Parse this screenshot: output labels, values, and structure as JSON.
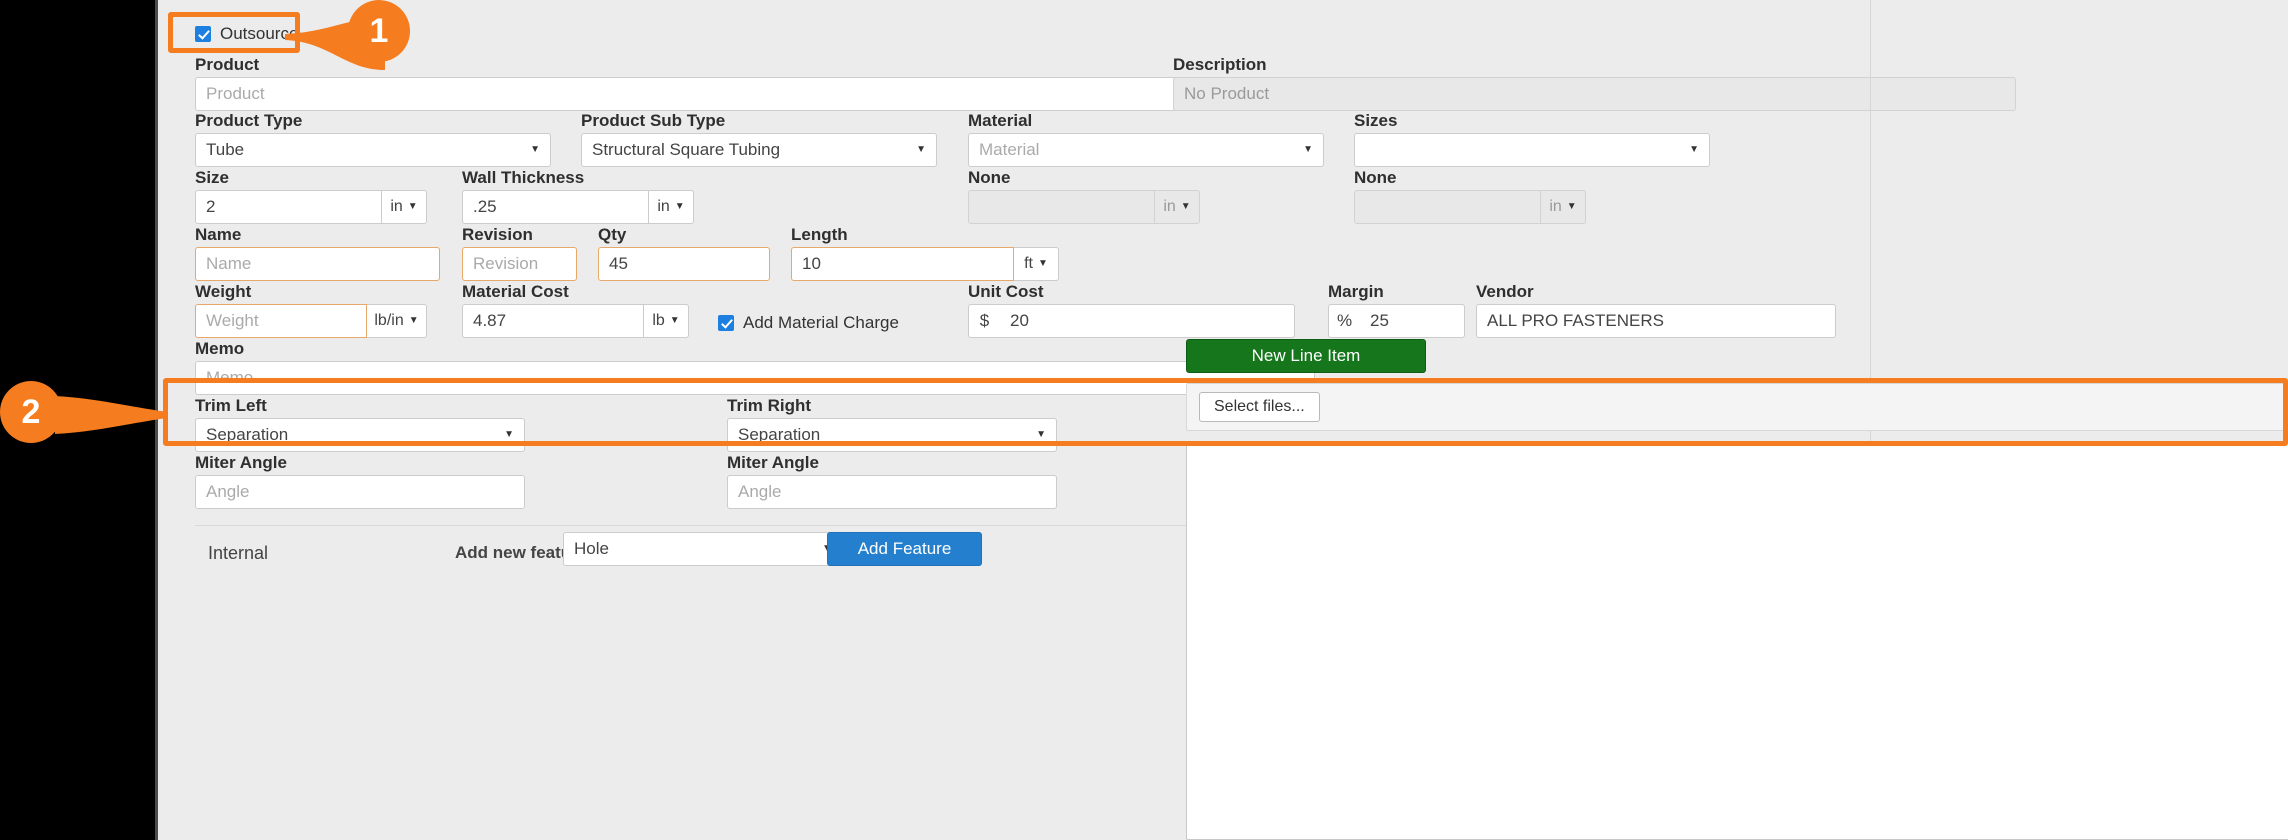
{
  "outsource": {
    "label": "Outsource",
    "checked": true
  },
  "fields": {
    "product": {
      "label": "Product",
      "value": "",
      "placeholder": "Product"
    },
    "description": {
      "label": "Description",
      "value": "",
      "placeholder": "No Product"
    },
    "product_type": {
      "label": "Product Type",
      "value": "Tube"
    },
    "product_subtype": {
      "label": "Product Sub Type",
      "value": "Structural Square Tubing"
    },
    "material": {
      "label": "Material",
      "value": "",
      "placeholder": "Material"
    },
    "sizes": {
      "label": "Sizes",
      "value": ""
    },
    "size": {
      "label": "Size",
      "value": "2",
      "unit": "in"
    },
    "wall_thickness": {
      "label": "Wall Thickness",
      "value": ".25",
      "unit": "in"
    },
    "none_1": {
      "label": "None",
      "value": "",
      "unit": "in"
    },
    "none_2": {
      "label": "None",
      "value": "",
      "unit": "in"
    },
    "name": {
      "label": "Name",
      "value": "",
      "placeholder": "Name"
    },
    "revision": {
      "label": "Revision",
      "value": "",
      "placeholder": "Revision"
    },
    "qty": {
      "label": "Qty",
      "value": "45"
    },
    "length": {
      "label": "Length",
      "value": "10",
      "unit": "ft"
    },
    "weight": {
      "label": "Weight",
      "value": "",
      "placeholder": "Weight",
      "unit": "lb/in"
    },
    "material_cost": {
      "label": "Material Cost",
      "value": "4.87",
      "unit": "lb"
    },
    "unit_cost": {
      "label": "Unit Cost",
      "value": "20",
      "prefix": "$"
    },
    "margin": {
      "label": "Margin",
      "value": "25",
      "prefix": "%"
    },
    "vendor": {
      "label": "Vendor",
      "value": "ALL PRO FASTENERS"
    },
    "memo": {
      "label": "Memo",
      "value": "",
      "placeholder": "Memo"
    },
    "trim_left": {
      "label": "Trim Left",
      "value": "Separation"
    },
    "trim_right": {
      "label": "Trim Right",
      "value": "Separation"
    },
    "miter_angle_left": {
      "label": "Miter Angle",
      "value": "",
      "placeholder": "Angle"
    },
    "miter_angle_right": {
      "label": "Miter Angle",
      "value": "",
      "placeholder": "Angle"
    }
  },
  "add_material_charge": {
    "label": "Add Material Charge",
    "checked": true
  },
  "buttons": {
    "new_line_item": "New Line Item",
    "select_files": "Select files...",
    "add_feature": "Add Feature"
  },
  "feature_section": {
    "internal_label": "Internal",
    "add_new_feature_label": "Add new feature",
    "feature_select_value": "Hole"
  },
  "annotations": [
    {
      "number": "1"
    },
    {
      "number": "2"
    }
  ],
  "colors": {
    "accent_orange": "#f57c1f",
    "green": "#16761b",
    "blue": "#2480ce",
    "checkbox_blue": "#1d7fe0"
  }
}
